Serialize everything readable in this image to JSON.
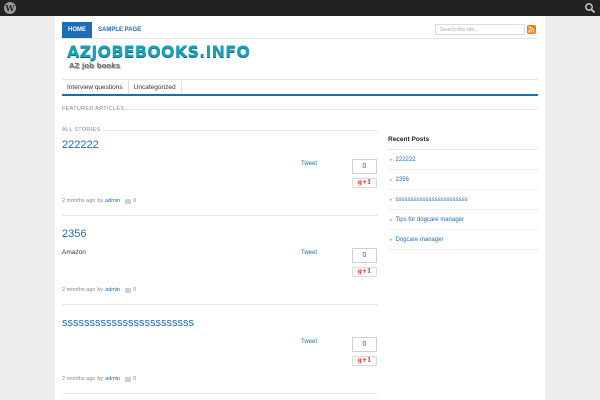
{
  "adminbar": {
    "logo_glyph": "W"
  },
  "topnav": {
    "items": [
      {
        "label": "HOME"
      },
      {
        "label": "SAMPLE PAGE"
      }
    ]
  },
  "search": {
    "placeholder": "Search this site..."
  },
  "logo": {
    "main": "AZJOBEBOOKS.INFO",
    "sub": "AZ job books"
  },
  "catnav": {
    "items": [
      {
        "label": "Interview questions"
      },
      {
        "label": "Uncategorized"
      }
    ]
  },
  "sections": {
    "featured": "FEATURED ARTICLES",
    "all_stories": "ALL STORIES"
  },
  "posts": [
    {
      "title": "222222",
      "excerpt": "",
      "tweet": "Tweet",
      "count": "0",
      "gplus": "g+1",
      "time": "2 months ago",
      "by": "by",
      "author": "admin",
      "comments": "0"
    },
    {
      "title": "2356",
      "excerpt": "Amazon",
      "tweet": "Tweet",
      "count": "0",
      "gplus": "g+1",
      "time": "2 months ago",
      "by": "by",
      "author": "admin",
      "comments": "0"
    },
    {
      "title": "ssssssssssssssssssssssss",
      "excerpt": "",
      "tweet": "Tweet",
      "count": "0",
      "gplus": "g+1",
      "time": "2 months ago",
      "by": "by",
      "author": "admin",
      "comments": "0"
    }
  ],
  "sidebar": {
    "title": "Recent Posts",
    "items": [
      {
        "label": "222222"
      },
      {
        "label": "2356"
      },
      {
        "label": "ssssssssssssssssssssssss"
      },
      {
        "label": "Tips for dogcare manager"
      },
      {
        "label": "Dogcare manager"
      }
    ]
  },
  "colors": {
    "accent": "#1e6bb8",
    "logo": "#1ba1b7",
    "adminbar": "#222222",
    "rss": "#f07c1c",
    "gplus": "#d23f31"
  }
}
